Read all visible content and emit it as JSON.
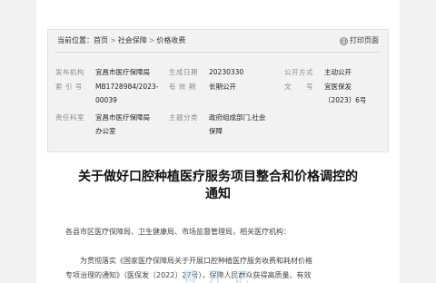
{
  "breadcrumb": {
    "prefix": "当前位置：",
    "items": [
      "首页",
      "社会保障",
      "价格收费"
    ],
    "separator": ">"
  },
  "print_label": "打印页面",
  "meta": {
    "publisher_label": "发布机构",
    "publisher_value": "宜昌市医疗保障局",
    "index_label": "索 引 号",
    "index_line1": "MB1728984/2023-",
    "index_line2": "00039",
    "responsible_label": "责任科室",
    "responsible_line1": "宜昌市医疗保障局",
    "responsible_line2": "办公室",
    "date_label": "生成日期",
    "date_value": "20230330",
    "validity_label": "有 效 期",
    "validity_value": "长期公开",
    "topic_label": "主题分类",
    "topic_line1": "政府组成部门,社会",
    "topic_line2": "保障",
    "open_label": "公开方式",
    "open_value": "主动公开",
    "doc_label": "文　　号",
    "doc_line1": "宜医保发",
    "doc_line2": "〔2023〕6号"
  },
  "title_line1": "关于做好口腔种植医疗服务项目整合和价格调控的",
  "title_line2": "通知",
  "body": {
    "salutation": "各县市区医疗保障局、卫生健康局、市场监督管理局，相关医疗机构：",
    "p1_line1": "为贯彻落实《国家医疗保障局关于开展口腔种植医疗服务收费和耗材价格",
    "p1_line2": "专项治理的通知》（医保发〔2022〕27号），保障人民群众获得高质量、有效"
  },
  "watermark": "看 开 记"
}
